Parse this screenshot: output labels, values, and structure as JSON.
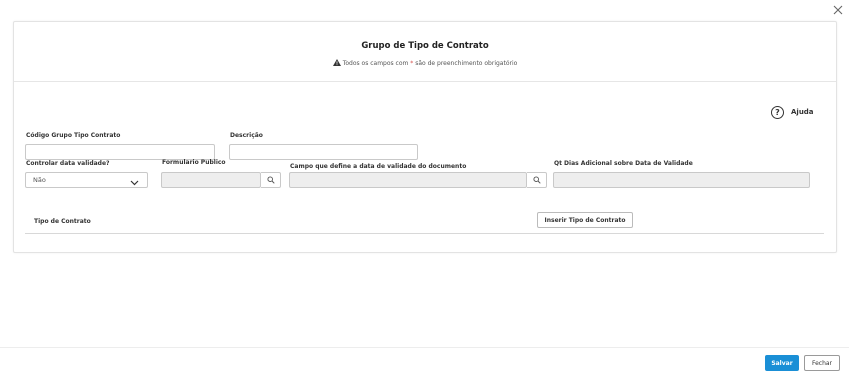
{
  "modal": {
    "title": "Grupo de Tipo de Contrato",
    "notice_prefix": "Todos os campos com",
    "notice_marker": "*",
    "notice_suffix": "são de preenchimento obrigatório",
    "help_label": "Ajuda"
  },
  "form": {
    "codigo_label": "Código Grupo Tipo Contrato",
    "codigo_value": "",
    "descricao_label": "Descrição",
    "descricao_value": "",
    "controlar_label": "Controlar data validade?",
    "controlar_value": "Não",
    "formulario_label": "Formulario Publico",
    "formulario_value": "",
    "campo_label": "Campo que define a data de validade do documento",
    "campo_value": "",
    "qt_dias_label": "Qt Dias Adicional sobre Data de Validade",
    "qt_dias_value": ""
  },
  "tipo_contrato": {
    "insert_button": "Inserir Tipo de Contrato",
    "column_header": "Tipo de Contrato"
  },
  "footer": {
    "save_label": "Salvar",
    "close_label": "Fechar"
  },
  "colors": {
    "primary": "#1a8fd6",
    "required": "#d9534f"
  },
  "icons": {
    "close": "close-icon",
    "warning": "warning-icon",
    "help": "help-circle-icon",
    "lookup": "magnifier-icon",
    "dropdown": "chevron-down-icon"
  }
}
